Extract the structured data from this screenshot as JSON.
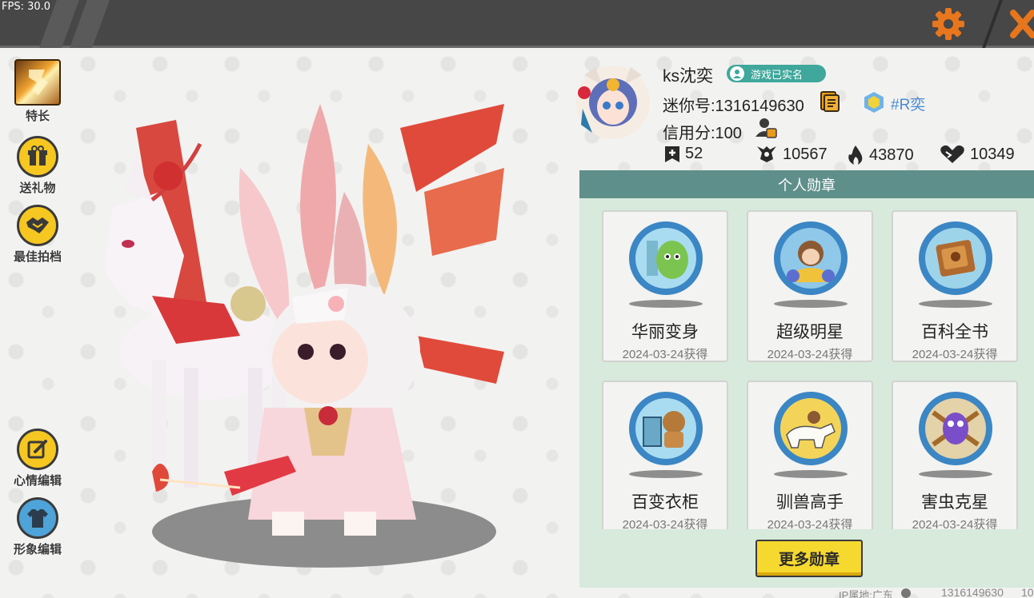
{
  "topbar": {
    "fps_label": "FPS: 30.0",
    "settings_icon": "gear-icon",
    "close_icon": "close-icon",
    "accent_color": "#e8761c"
  },
  "left_menu": [
    {
      "label": "特长",
      "icon": "specialty-icon"
    },
    {
      "label": "送礼物",
      "icon": "gift-icon"
    },
    {
      "label": "最佳拍档",
      "icon": "handshake-icon"
    },
    {
      "label": "心情编辑",
      "icon": "edit-icon"
    },
    {
      "label": "形象编辑",
      "icon": "outfit-icon"
    }
  ],
  "profile": {
    "nickname": "ks沈奕",
    "realname_badge": "游戏已实名",
    "uid_text": "迷你号:1316149630",
    "clan_name": "#R奕",
    "credit_text": "信用分:100",
    "stats": [
      {
        "icon": "plus-book-icon",
        "value": "52"
      },
      {
        "icon": "trophy-icon",
        "value": "10567"
      },
      {
        "icon": "flame-icon",
        "value": "43870"
      },
      {
        "icon": "heart-icon",
        "value": "10349"
      }
    ]
  },
  "medals": {
    "title": "个人勋章",
    "items": [
      {
        "name": "华丽变身",
        "date": "2024-03-24获得"
      },
      {
        "name": "超级明星",
        "date": "2024-03-24获得"
      },
      {
        "name": "百科全书",
        "date": "2024-03-24获得"
      },
      {
        "name": "百变衣柜",
        "date": "2024-03-24获得"
      },
      {
        "name": "驯兽高手",
        "date": "2024-03-24获得"
      },
      {
        "name": "害虫克星",
        "date": "2024-03-24获得"
      }
    ],
    "more_label": "更多勋章"
  },
  "footer": {
    "ip_label": "IP属地:广东",
    "uid": "1316149630",
    "extra": "10"
  }
}
